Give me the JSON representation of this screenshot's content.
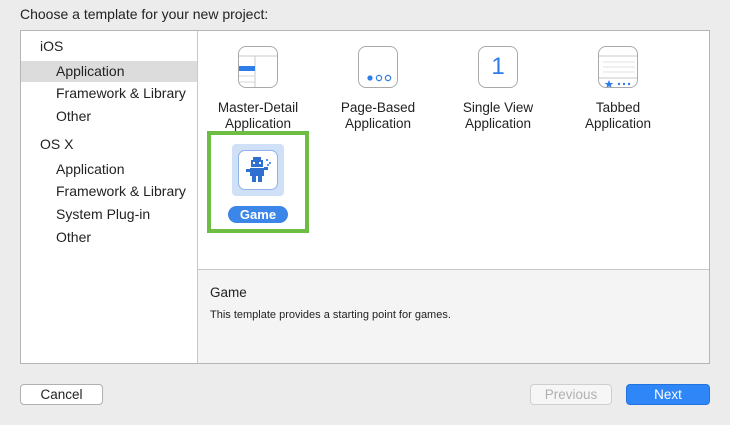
{
  "dialog": {
    "heading": "Choose a template for your new project:"
  },
  "sidebar": {
    "sections": [
      {
        "header": "iOS",
        "items": [
          "Application",
          "Framework & Library",
          "Other"
        ]
      },
      {
        "header": "OS X",
        "items": [
          "Application",
          "Framework & Library",
          "System Plug-in",
          "Other"
        ]
      }
    ],
    "selected": "iOS / Application"
  },
  "templates": [
    {
      "label": "Master-Detail\nApplication",
      "icon": "master-detail-icon"
    },
    {
      "label": "Page-Based\nApplication",
      "icon": "page-based-icon"
    },
    {
      "label": "Single View\nApplication",
      "icon": "single-view-icon",
      "icon_text": "1"
    },
    {
      "label": "Tabbed\nApplication",
      "icon": "tabbed-icon"
    },
    {
      "label": "Game",
      "icon": "game-icon",
      "selected": true
    }
  ],
  "description": {
    "title": "Game",
    "text": "This template provides a starting point for games."
  },
  "buttons": {
    "cancel": "Cancel",
    "previous": "Previous",
    "next": "Next"
  },
  "colors": {
    "accent": "#2f86f6",
    "highlight": "#6dbd44",
    "selection_bg": "#dcdcdc"
  }
}
